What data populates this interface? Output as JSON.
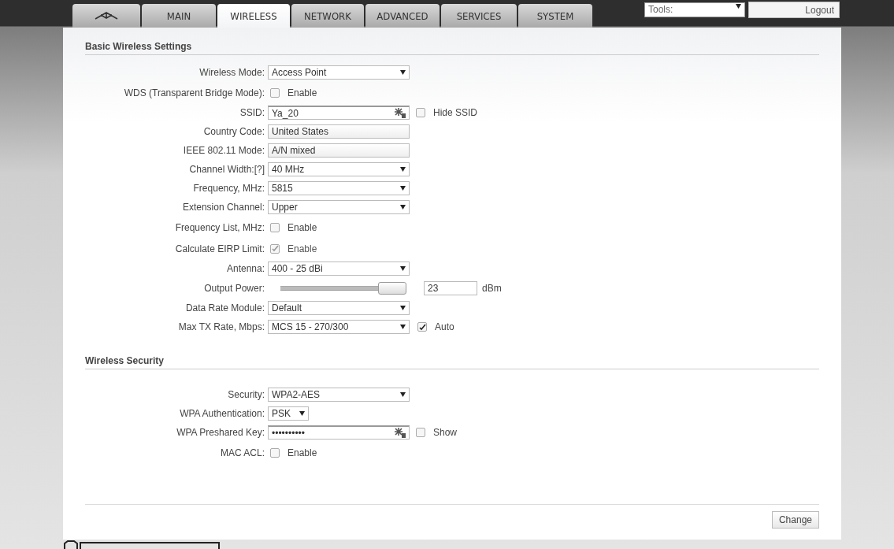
{
  "tabs": [
    {
      "kind": "logo",
      "selected": false
    },
    {
      "kind": "text",
      "label": "MAIN",
      "selected": false
    },
    {
      "kind": "text",
      "label": "WIRELESS",
      "selected": true
    },
    {
      "kind": "text",
      "label": "NETWORK",
      "selected": false
    },
    {
      "kind": "text",
      "label": "ADVANCED",
      "selected": false
    },
    {
      "kind": "text",
      "label": "SERVICES",
      "selected": false
    },
    {
      "kind": "text",
      "label": "SYSTEM",
      "selected": false
    }
  ],
  "tools": {
    "value": "Tools:"
  },
  "logout": "Logout",
  "sections": [
    {
      "title": "Basic Wireless Settings",
      "rows": [
        {
          "label": "Wireless Mode:",
          "kind": "select",
          "value": "Access Point"
        },
        {
          "label": "WDS (Transparent Bridge Mode):",
          "kind": "checkbox",
          "checked": false,
          "option": "Enable"
        },
        {
          "label": "SSID:",
          "kind": "text",
          "value": "Ya_20",
          "extra": {
            "label": "Hide SSID",
            "checked": false
          }
        },
        {
          "label": "Country Code:",
          "kind": "readonly",
          "value": "United States"
        },
        {
          "label": "IEEE 802.11 Mode:",
          "kind": "readonly",
          "value": "A/N mixed"
        },
        {
          "label": "Channel Width:[?]",
          "kind": "select",
          "value": "40 MHz"
        },
        {
          "label": "Frequency, MHz:",
          "kind": "select",
          "value": "5815"
        },
        {
          "label": "Extension Channel:",
          "kind": "select",
          "value": "Upper"
        },
        {
          "label": "Frequency List, MHz:",
          "kind": "checkbox",
          "checked": false,
          "option": "Enable"
        },
        {
          "label": "Calculate EIRP Limit:",
          "kind": "checkbox",
          "checked": true,
          "disabled": true,
          "option": "Enable"
        },
        {
          "label": "Antenna:",
          "kind": "select",
          "value": "400 - 25 dBi"
        },
        {
          "label": "Output Power:",
          "kind": "slider",
          "level": 1,
          "value": "23",
          "unit": "dBm"
        },
        {
          "label": "Data Rate Module:",
          "kind": "select",
          "value": "Default"
        },
        {
          "label": "Max TX Rate, Mbps:",
          "kind": "select",
          "value": "MCS 15 - 270/300",
          "extra": {
            "label": "Auto",
            "checked": true
          }
        }
      ]
    },
    {
      "title": "Wireless Security",
      "rows": [
        {
          "label": "Security:",
          "kind": "select",
          "value": "WPA2-AES"
        },
        {
          "label": "WPA Authentication:",
          "kind": "smallselect",
          "value": "PSK"
        },
        {
          "label": "WPA Preshared Key:",
          "kind": "text",
          "value": "••••••••••",
          "extra": {
            "label": "Show",
            "checked": false
          }
        },
        {
          "label": "MAC ACL:",
          "kind": "checkbox",
          "checked": false,
          "option": "Enable"
        }
      ]
    }
  ],
  "change": "Change"
}
